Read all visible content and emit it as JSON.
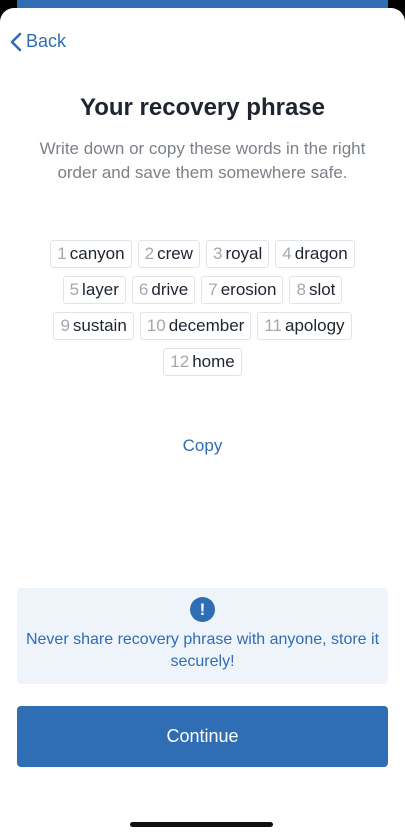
{
  "nav": {
    "back_label": "Back"
  },
  "header": {
    "title": "Your recovery phrase",
    "subtitle": "Write down or copy these words in the right order and save them somewhere safe."
  },
  "phrase": {
    "words": [
      {
        "num": "1",
        "word": "canyon"
      },
      {
        "num": "2",
        "word": "crew"
      },
      {
        "num": "3",
        "word": "royal"
      },
      {
        "num": "4",
        "word": "dragon"
      },
      {
        "num": "5",
        "word": "layer"
      },
      {
        "num": "6",
        "word": "drive"
      },
      {
        "num": "7",
        "word": "erosion"
      },
      {
        "num": "8",
        "word": "slot"
      },
      {
        "num": "9",
        "word": "sustain"
      },
      {
        "num": "10",
        "word": "december"
      },
      {
        "num": "11",
        "word": "apology"
      },
      {
        "num": "12",
        "word": "home"
      }
    ],
    "copy_label": "Copy"
  },
  "warning": {
    "icon": "exclamation-circle-icon",
    "text": "Never share recovery phrase with anyone, store it securely!"
  },
  "footer": {
    "continue_label": "Continue"
  },
  "colors": {
    "accent": "#2f6db5",
    "warning_bg": "#eef4f9"
  }
}
